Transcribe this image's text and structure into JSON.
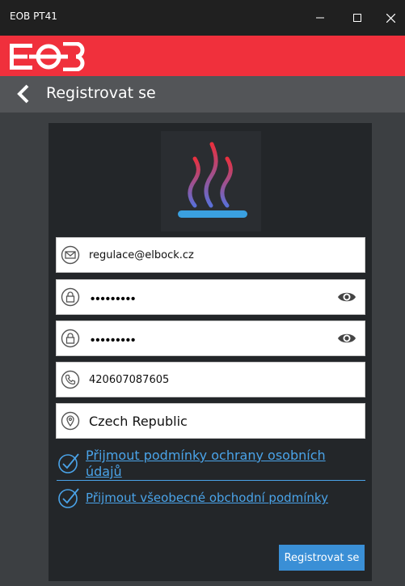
{
  "window": {
    "title": "EOB PT41"
  },
  "header": {
    "brand": "EOB"
  },
  "nav": {
    "title": "Registrovat se"
  },
  "form": {
    "email": "regulace@elbock.cz",
    "password": "•••••••••",
    "password_confirm": "•••••••••",
    "phone": "420607087605",
    "country": "Czech Republic",
    "accept_privacy": "Přijmout podmínky ochrany osobních údajů",
    "accept_terms": "Přijmout všeobecné obchodní podmínky",
    "submit_label": "Registrovat se"
  },
  "colors": {
    "brand_red": "#f0303c",
    "link_blue": "#4aa3e8",
    "button_blue": "#3a8fd6"
  },
  "icons": [
    "email-icon",
    "lock-icon",
    "eye-icon",
    "phone-icon",
    "location-icon",
    "checkmark-icon",
    "back-arrow-icon",
    "heating-logo-icon"
  ]
}
